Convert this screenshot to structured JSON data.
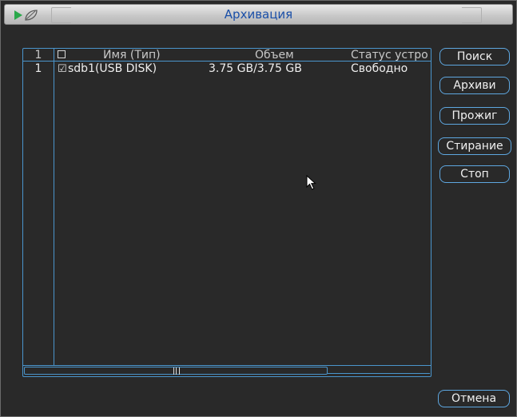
{
  "window": {
    "title": "Архивация"
  },
  "table": {
    "header": {
      "index": "1",
      "name": "Имя (Тип)",
      "size": "Объем",
      "status": "Статус устро"
    },
    "rows": [
      {
        "index": "1",
        "checked": true,
        "name": "sdb1(USB DISK)",
        "size": "3.75 GB/3.75 GB",
        "status": "Свободно"
      }
    ]
  },
  "buttons": {
    "search": "Поиск",
    "archive": "Архиви",
    "burn": "Прожиг",
    "erase": "Стирание",
    "stop": "Стоп",
    "cancel": "Отмена"
  },
  "icons": {
    "logo": "play-arrow-and-leaf-icon",
    "checkbox_unchecked": "☐",
    "checkbox_checked": "☑",
    "cursor": "mouse-pointer-icon"
  },
  "colors": {
    "background": "#292929",
    "accent_border": "#4a95cc",
    "title_text": "#1a4fa8"
  }
}
